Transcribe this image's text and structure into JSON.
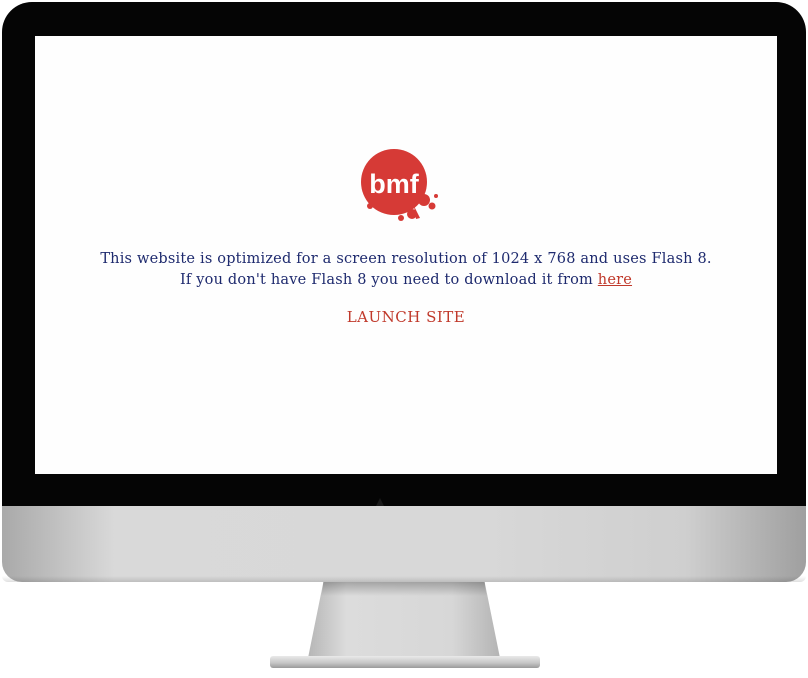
{
  "brand": {
    "logo_text": "bmf",
    "logo_color": "#d63a36"
  },
  "content": {
    "line1": "This website is optimized for a screen resolution of 1024 x 768 and uses Flash 8.",
    "line2_prefix": "If you don't have Flash 8 you need to download it from ",
    "download_link": "here",
    "launch_label": "LAUNCH SITE"
  },
  "colors": {
    "text": "#1e2a6e",
    "accent": "#c0392b",
    "bezel": "#050505",
    "chin": "#d8d8d8"
  }
}
